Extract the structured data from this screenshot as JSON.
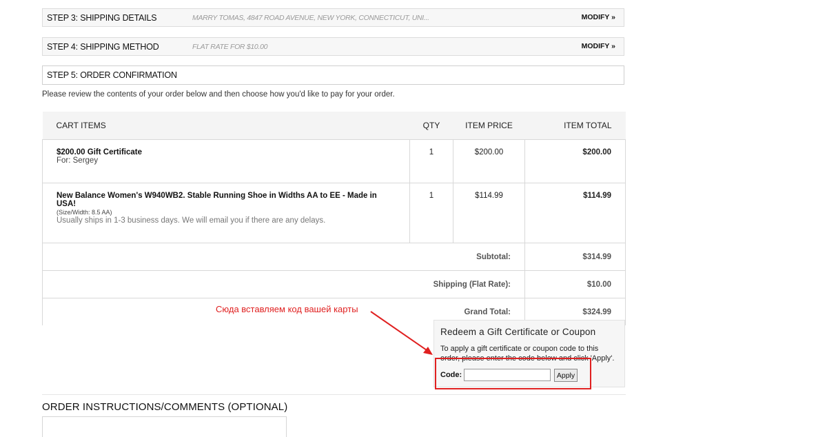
{
  "steps": [
    {
      "title": "STEP 3: SHIPPING DETAILS",
      "summary": "MARRY TOMAS, 4847 ROAD AVENUE, NEW YORK, CONNECTICUT, UNI...",
      "modify": "MODIFY »"
    },
    {
      "title": "STEP 4: SHIPPING METHOD",
      "summary": "FLAT RATE FOR $10.00",
      "modify": "MODIFY »"
    },
    {
      "title": "STEP 5: ORDER CONFIRMATION"
    }
  ],
  "intro": "Please review the contents of your order below and then choose how you'd like to pay for your order.",
  "cart": {
    "headers": {
      "items": "CART ITEMS",
      "qty": "QTY",
      "price": "ITEM PRICE",
      "total": "ITEM TOTAL"
    },
    "rows": [
      {
        "name": "$200.00 Gift Certificate",
        "sub": "For: Sergey",
        "qty": "1",
        "price": "$200.00",
        "total": "$200.00"
      },
      {
        "name": "New Balance Women's W940WB2. Stable Running Shoe in Widths AA to EE - Made in USA!",
        "size": "(Size/Width: 8.5 AA)",
        "note": "Usually ships in 1-3 business days. We will email you if there are any delays.",
        "qty": "1",
        "price": "$114.99",
        "total": "$114.99"
      }
    ],
    "summary": [
      {
        "label": "Subtotal:",
        "value": "$314.99"
      },
      {
        "label": "Shipping (Flat Rate):",
        "value": "$10.00"
      },
      {
        "label": "Grand Total:",
        "value": "$324.99"
      }
    ]
  },
  "annotation": "Сюда вставляем код вашей карты",
  "redeem": {
    "title": "Redeem a Gift Certificate or Coupon",
    "text": "To apply a gift certificate or coupon code to this order, please enter the code below and click 'Apply'.",
    "code_label": "Code:",
    "code_value": "",
    "apply_label": "Apply"
  },
  "order_comments": {
    "title": "ORDER INSTRUCTIONS/COMMENTS (OPTIONAL)"
  },
  "colors": {
    "annotation_red": "#e02020"
  }
}
